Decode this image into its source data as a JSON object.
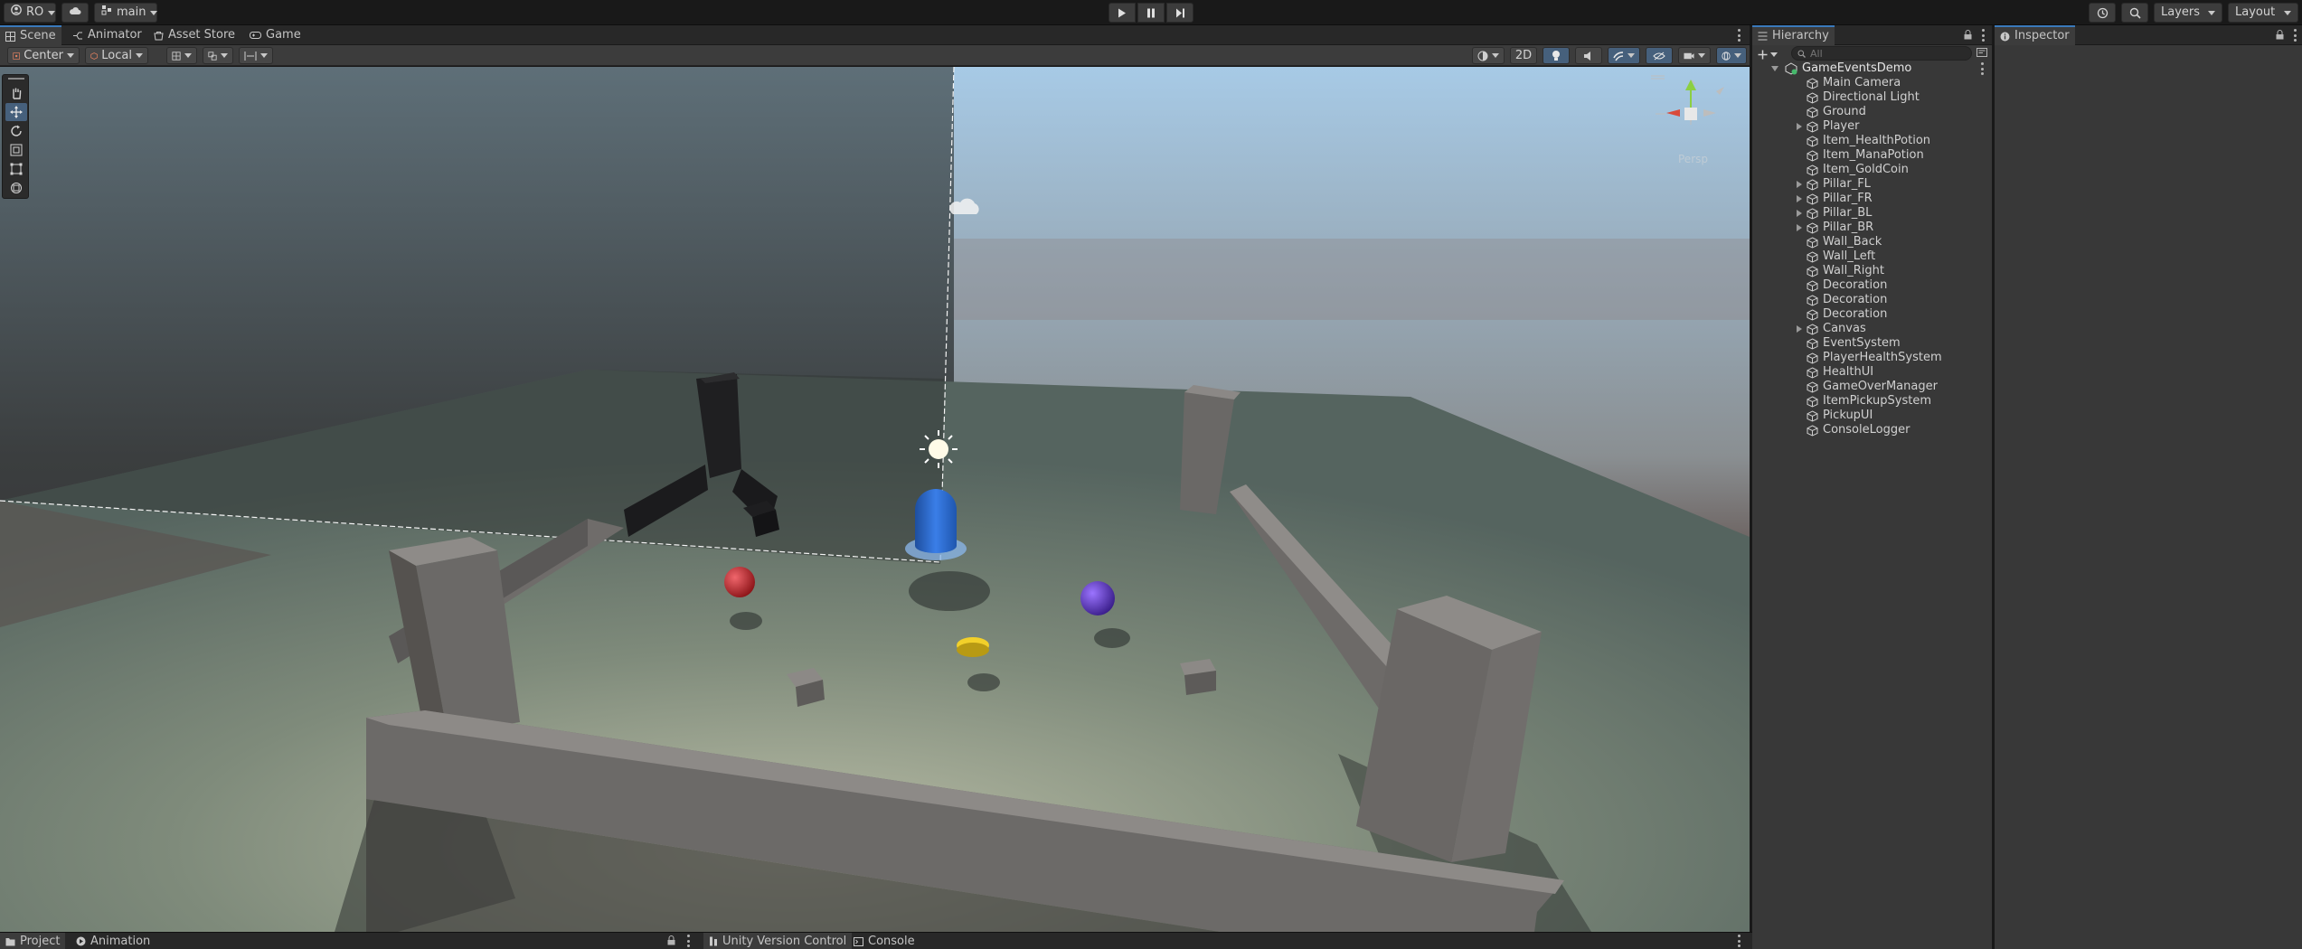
{
  "toolbar": {
    "account_label": "RO",
    "branch_label": "main",
    "layers_label": "Layers",
    "layout_label": "Layout"
  },
  "scene_tabs": [
    {
      "label": "Scene",
      "icon": "grid-icon"
    },
    {
      "label": "Animator",
      "icon": "animator-icon"
    },
    {
      "label": "Asset Store",
      "icon": "store-icon"
    },
    {
      "label": "Game",
      "icon": "gamepad-icon"
    }
  ],
  "scene_toolbar": {
    "pivot_label": "Center",
    "space_label": "Local",
    "toggle_2d_label": "2D"
  },
  "hierarchy": {
    "title": "Hierarchy",
    "search_placeholder": "All",
    "scene_name": "GameEventsDemo",
    "items": [
      {
        "label": "Main Camera",
        "expandable": false
      },
      {
        "label": "Directional Light",
        "expandable": false
      },
      {
        "label": "Ground",
        "expandable": false
      },
      {
        "label": "Player",
        "expandable": true
      },
      {
        "label": "Item_HealthPotion",
        "expandable": false
      },
      {
        "label": "Item_ManaPotion",
        "expandable": false
      },
      {
        "label": "Item_GoldCoin",
        "expandable": false
      },
      {
        "label": "Pillar_FL",
        "expandable": true
      },
      {
        "label": "Pillar_FR",
        "expandable": true
      },
      {
        "label": "Pillar_BL",
        "expandable": true
      },
      {
        "label": "Pillar_BR",
        "expandable": true
      },
      {
        "label": "Wall_Back",
        "expandable": false
      },
      {
        "label": "Wall_Left",
        "expandable": false
      },
      {
        "label": "Wall_Right",
        "expandable": false
      },
      {
        "label": "Decoration",
        "expandable": false
      },
      {
        "label": "Decoration",
        "expandable": false
      },
      {
        "label": "Decoration",
        "expandable": false
      },
      {
        "label": "Canvas",
        "expandable": true
      },
      {
        "label": "EventSystem",
        "expandable": false
      },
      {
        "label": "PlayerHealthSystem",
        "expandable": false
      },
      {
        "label": "HealthUI",
        "expandable": false
      },
      {
        "label": "GameOverManager",
        "expandable": false
      },
      {
        "label": "ItemPickupSystem",
        "expandable": false
      },
      {
        "label": "PickupUI",
        "expandable": false
      },
      {
        "label": "ConsoleLogger",
        "expandable": false
      }
    ]
  },
  "inspector": {
    "title": "Inspector"
  },
  "gizmo": {
    "view_label": "Persp"
  },
  "bottom_tabs_left": [
    {
      "label": "Project",
      "icon": "folder-icon"
    },
    {
      "label": "Animation",
      "icon": "animation-icon"
    }
  ],
  "bottom_tabs_right": [
    {
      "label": "Unity Version Control",
      "icon": "version-control-icon"
    },
    {
      "label": "Console",
      "icon": "console-icon"
    }
  ],
  "colors": {
    "accent": "#3a79bb",
    "selection": "#46607c",
    "player": "#2f6fd6",
    "health_potion": "#c2242c",
    "mana_potion": "#6a3fd0",
    "gold_coin": "#f2d02a"
  }
}
